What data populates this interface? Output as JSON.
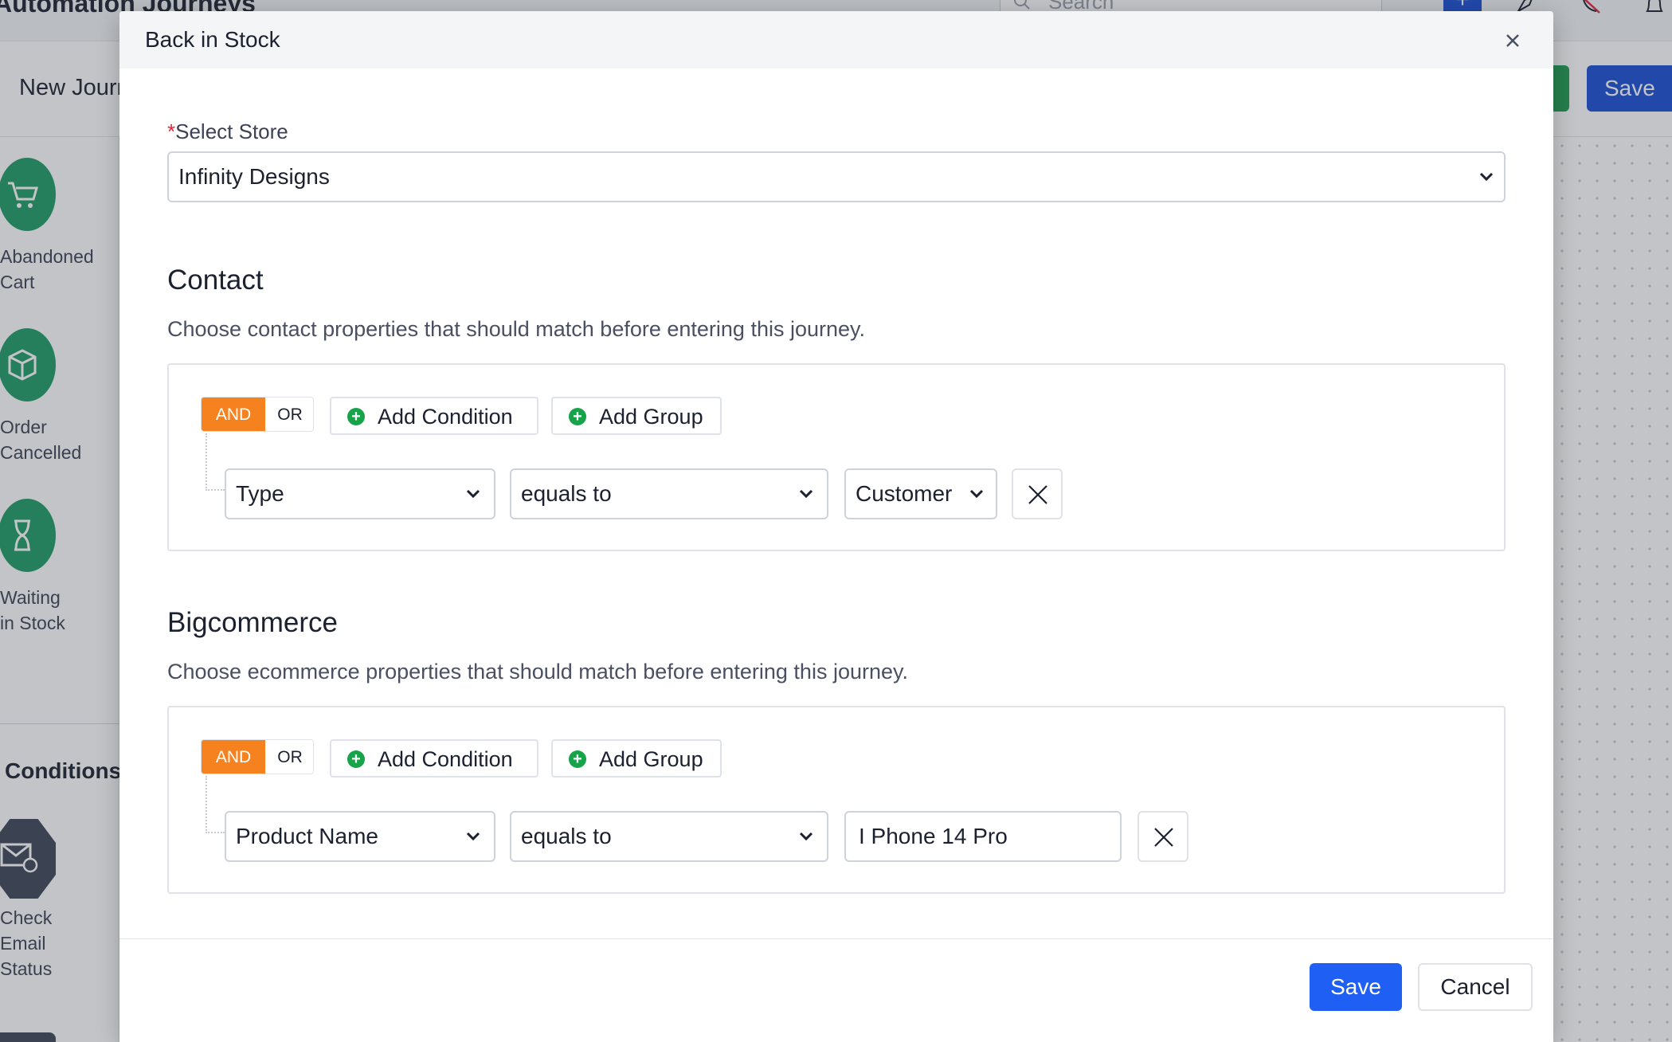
{
  "background": {
    "app_title": "Automation Journeys",
    "search_placeholder": "Search",
    "journey_name": "New Journey",
    "save_label": "Save",
    "triggers": [
      {
        "label": "Abandoned\nCart",
        "icon": "cart-x-icon"
      },
      {
        "label": "Order\nCancelled",
        "icon": "box-x-icon"
      },
      {
        "label": "Waiting\nin Stock",
        "icon": "hourglass-icon"
      }
    ],
    "conditions_title": "Conditions",
    "conditions": [
      {
        "label": "Check\nEmail\nStatus",
        "icon": "mail-clock-icon"
      }
    ]
  },
  "modal": {
    "title": "Back in Stock",
    "store": {
      "required_mark": "*",
      "label": "Select Store",
      "value": "Infinity Designs"
    },
    "contact": {
      "title": "Contact",
      "description": "Choose contact properties that should match before entering this journey.",
      "logic": {
        "and": "AND",
        "or": "OR",
        "active": "AND"
      },
      "add_condition": "Add Condition",
      "add_group": "Add Group",
      "condition": {
        "field": "Type",
        "operator": "equals to",
        "value": "Customer"
      }
    },
    "bigcommerce": {
      "title": "Bigcommerce",
      "description": "Choose ecommerce properties that should match before entering this journey.",
      "logic": {
        "and": "AND",
        "or": "OR",
        "active": "AND"
      },
      "add_condition": "Add Condition",
      "add_group": "Add Group",
      "condition": {
        "field": "Product Name",
        "operator": "equals to",
        "value": "I Phone 14 Pro"
      }
    },
    "footer": {
      "save": "Save",
      "cancel": "Cancel"
    }
  },
  "colors": {
    "accent_blue": "#1f5ff3",
    "and_orange": "#f6821f",
    "add_green": "#16a34a",
    "required_red": "#e0243b"
  }
}
